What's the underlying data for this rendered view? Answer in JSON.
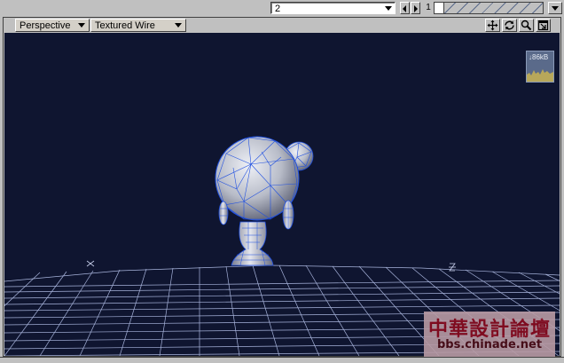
{
  "layer_select": {
    "value": "2"
  },
  "frame": {
    "current": "1"
  },
  "viewport": {
    "view_mode": "Perspective",
    "render_mode": "Textured Wire",
    "controls": [
      "move-icon",
      "rotate-icon",
      "zoom-icon",
      "maximize-icon"
    ]
  },
  "memory": {
    "label": "↓86kB"
  },
  "watermark": {
    "title": "中華設計論壇",
    "url": "bbs.chinade.net"
  },
  "axes": {
    "x_label": "X",
    "z_label": "Z"
  },
  "colors": {
    "viewport_bg": "#0f1530",
    "grid": "#a8b4dc",
    "wire": "#2050e0",
    "model": "#c8ccd8"
  }
}
